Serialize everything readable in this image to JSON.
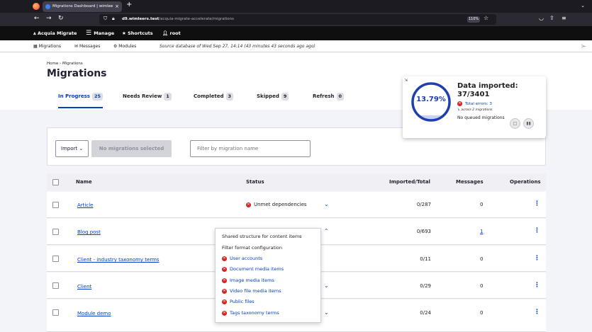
{
  "browser": {
    "tab_title": "Migrations Dashboard | wimlee",
    "url_host": "d9.wimleers.test",
    "url_path": "/acquia-migrate-accelerate/migrations",
    "zoom": "110%"
  },
  "toolbar": {
    "acquia_migrate": "Acquia Migrate",
    "manage": "Manage",
    "shortcuts": "Shortcuts",
    "user": "root"
  },
  "am_bar": {
    "migrations": "Migrations",
    "messages": "Messages",
    "modules": "Modules",
    "source_info": "Source database of Wed Sep 27, 14:14 (43 minutes 43 seconds ago ago)"
  },
  "breadcrumb": {
    "home": "Home",
    "sep": "›",
    "current": "Migrations"
  },
  "page_title": "Migrations",
  "tabs": [
    {
      "label": "In Progress",
      "count": "25"
    },
    {
      "label": "Needs Review",
      "count": "1"
    },
    {
      "label": "Completed",
      "count": "3"
    },
    {
      "label": "Skipped",
      "count": "9"
    },
    {
      "label": "Refresh",
      "count": "0"
    }
  ],
  "filters": {
    "import_label": "Import",
    "no_selection": "No migrations selected",
    "filter_placeholder": "Filter by migration name"
  },
  "table": {
    "headers": {
      "name": "Name",
      "status": "Status",
      "imported": "Imported/Total",
      "messages": "Messages",
      "operations": "Operations"
    },
    "rows": [
      {
        "name": "Article",
        "status": "Unmet dependencies",
        "imported": "0/287",
        "messages": "0"
      },
      {
        "name": "Blog post",
        "status": "",
        "imported": "0/693",
        "messages": "1"
      },
      {
        "name": "Client - industry taxonomy terms",
        "status": "",
        "imported": "0/11",
        "messages": "0"
      },
      {
        "name": "Client",
        "status": "",
        "imported": "0/29",
        "messages": "0"
      },
      {
        "name": "Module demo",
        "status": "",
        "imported": "0/24",
        "messages": "0"
      }
    ]
  },
  "dependencies_dropdown": {
    "items": [
      {
        "label": "Shared structure for content items",
        "error": false
      },
      {
        "label": "Filter format configuration",
        "error": false
      },
      {
        "label": "User accounts",
        "error": true
      },
      {
        "label": "Document media items",
        "error": true
      },
      {
        "label": "Image media items",
        "error": true
      },
      {
        "label": "Video file media items",
        "error": true
      },
      {
        "label": "Public files",
        "error": true
      },
      {
        "label": "Tags taxonomy terms",
        "error": true
      }
    ]
  },
  "import_status": {
    "percent_label": "13.79%",
    "percent_value": 13.79,
    "heading": "Data imported:",
    "count": "37/3401",
    "errors": "Total errors: 3",
    "across": "↳ across 2 migrations",
    "queue": "No queued migrations"
  },
  "colors": {
    "accent": "#003ecc",
    "error": "#d72222",
    "ring": "#1e3fb2"
  }
}
